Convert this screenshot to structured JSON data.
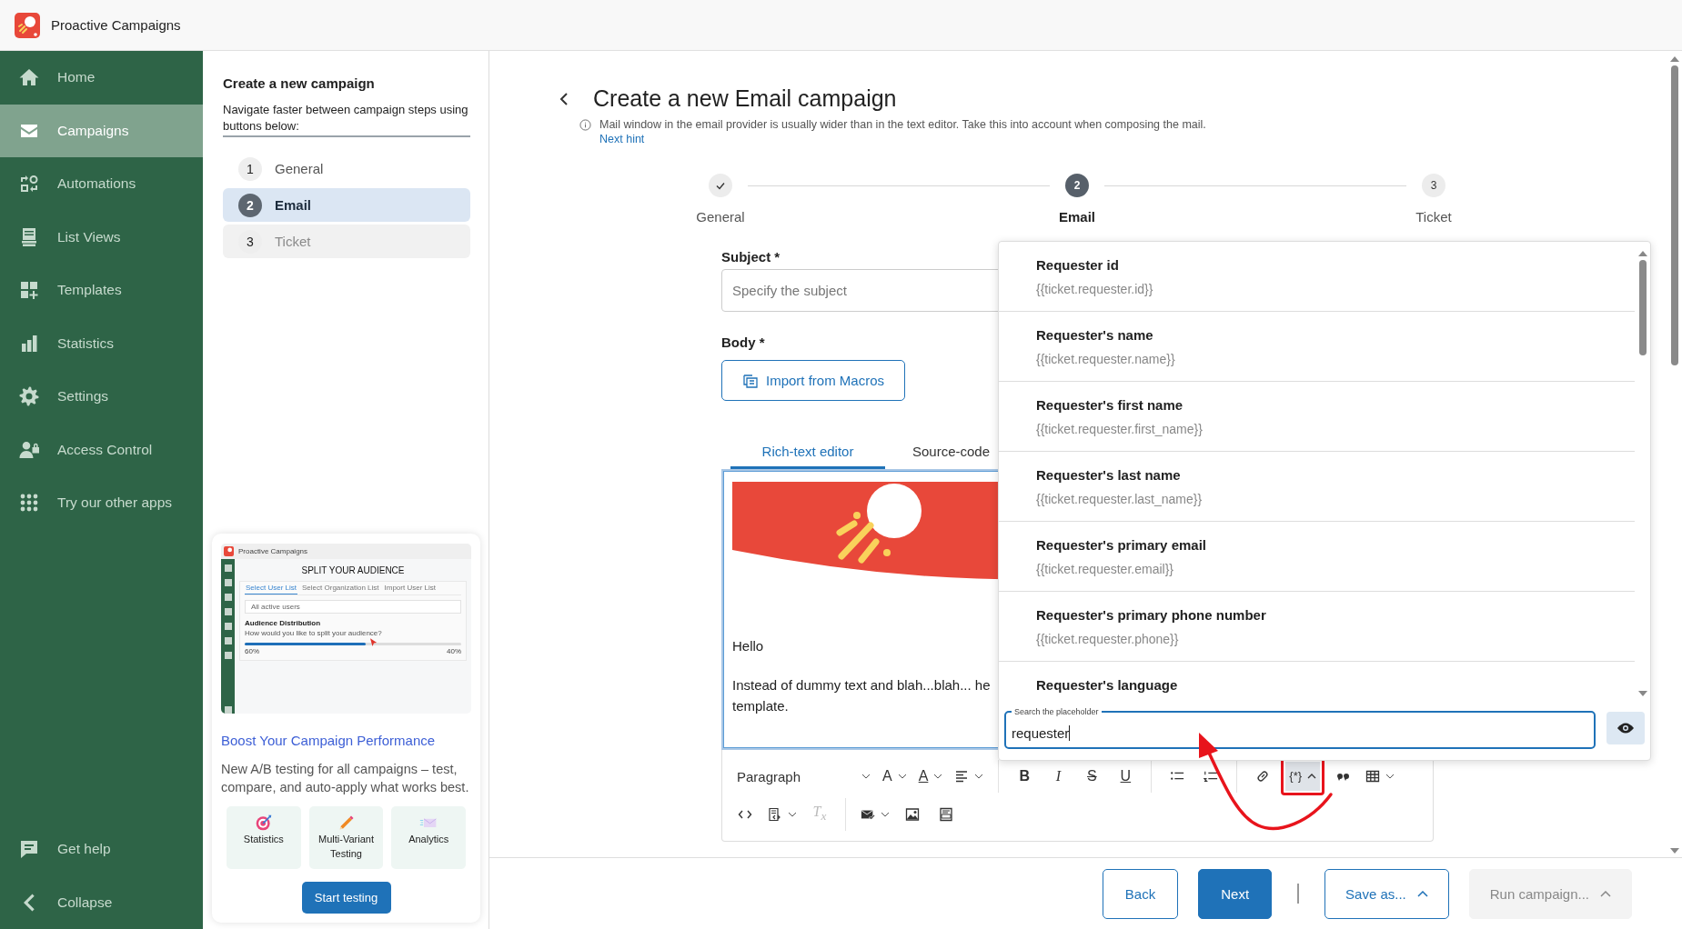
{
  "app": {
    "title": "Proactive Campaigns"
  },
  "sidebar": {
    "items": [
      {
        "label": "Home",
        "selected": false
      },
      {
        "label": "Campaigns",
        "selected": true
      },
      {
        "label": "Automations",
        "selected": false
      },
      {
        "label": "List Views",
        "selected": false
      },
      {
        "label": "Templates",
        "selected": false
      },
      {
        "label": "Statistics",
        "selected": false
      },
      {
        "label": "Settings",
        "selected": false
      },
      {
        "label": "Access Control",
        "selected": false
      },
      {
        "label": "Try our other apps",
        "selected": false
      }
    ],
    "footer": [
      {
        "label": "Get help"
      },
      {
        "label": "Collapse"
      }
    ]
  },
  "steps_panel": {
    "title": "Create a new campaign",
    "hint": "Navigate faster between campaign steps using buttons below:",
    "steps": [
      {
        "number": "1",
        "label": "General",
        "selected": false,
        "disabled": false
      },
      {
        "number": "2",
        "label": "Email",
        "selected": true,
        "disabled": false
      },
      {
        "number": "3",
        "label": "Ticket",
        "selected": false,
        "disabled": true
      }
    ]
  },
  "promo": {
    "preview": {
      "app_title": "Proactive Campaigns",
      "title": "SPLIT YOUR AUDIENCE",
      "tabs": [
        {
          "label": "Select User List",
          "selected": true
        },
        {
          "label": "Select Organization List",
          "selected": false
        },
        {
          "label": "Import User List",
          "selected": false
        }
      ],
      "select_value": "All active users",
      "section_title": "Audience Distribution",
      "question": "How would you like to split your audience?",
      "split": {
        "level": 0.56
      },
      "left_reading": "60%",
      "right_reading": "40%"
    },
    "title": "Boost Your Campaign Performance",
    "text": "New A/B testing for all campaigns – test, compare, and auto-apply what works best.",
    "features": [
      {
        "label": "Statistics"
      },
      {
        "label": "Multi-Variant Testing"
      },
      {
        "label": "Analytics"
      }
    ],
    "button": "Start testing"
  },
  "page": {
    "title": "Create a new Email campaign",
    "hint": "Mail window in the email provider is usually wider than in the text editor. Take this into account when composing the mail.",
    "next_hint": "Next hint",
    "stepper": [
      {
        "label": "General",
        "completed": true,
        "selected": false
      },
      {
        "number": "2",
        "label": "Email",
        "completed": false,
        "selected": true
      },
      {
        "number": "3",
        "label": "Ticket",
        "completed": false,
        "selected": false
      }
    ],
    "subject": {
      "label": "Subject *",
      "placeholder": "Specify the subject"
    },
    "body": {
      "label": "Body *",
      "import_button": "Import from Macros"
    },
    "editor_tabs": [
      {
        "label": "Rich-text editor",
        "selected": true
      },
      {
        "label": "Source-code",
        "selected": false
      }
    ],
    "editor": {
      "greeting": "Hello",
      "lines": [
        "Instead of dummy text and blah...blah... he",
        "template."
      ]
    },
    "toolbar": {
      "format": "Paragraph",
      "glyphs": {
        "font_size": "A",
        "font_color": "A",
        "bold": "B",
        "italic": "I",
        "strike": "S",
        "underline": "U",
        "placeholder": "{*}",
        "clear": "T$_{x}$"
      },
      "clear_disabled": true,
      "placeholder_open": true
    },
    "placeholder_menu": {
      "items": [
        {
          "title": "Requester id",
          "code": "{{ticket.requester.id}}"
        },
        {
          "title": "Requester's name",
          "code": "{{ticket.requester.name}}"
        },
        {
          "title": "Requester's first name",
          "code": "{{ticket.requester.first_name}}"
        },
        {
          "title": "Requester's last name",
          "code": "{{ticket.requester.last_name}}"
        },
        {
          "title": "Requester's primary email",
          "code": "{{ticket.requester.email}}"
        },
        {
          "title": "Requester's primary phone number",
          "code": "{{ticket.requester.phone}}"
        },
        {
          "title": "Requester's language"
        }
      ],
      "search": {
        "label": "Search the placeholder",
        "value": "requester"
      }
    },
    "actions": [
      {
        "label": "Back",
        "kind": "outline"
      },
      {
        "label": "Next",
        "kind": "primary"
      },
      {
        "label": "Save as...",
        "kind": "menu",
        "disabled": false
      },
      {
        "label": "Run campaign...",
        "kind": "menu",
        "disabled": true
      }
    ]
  }
}
